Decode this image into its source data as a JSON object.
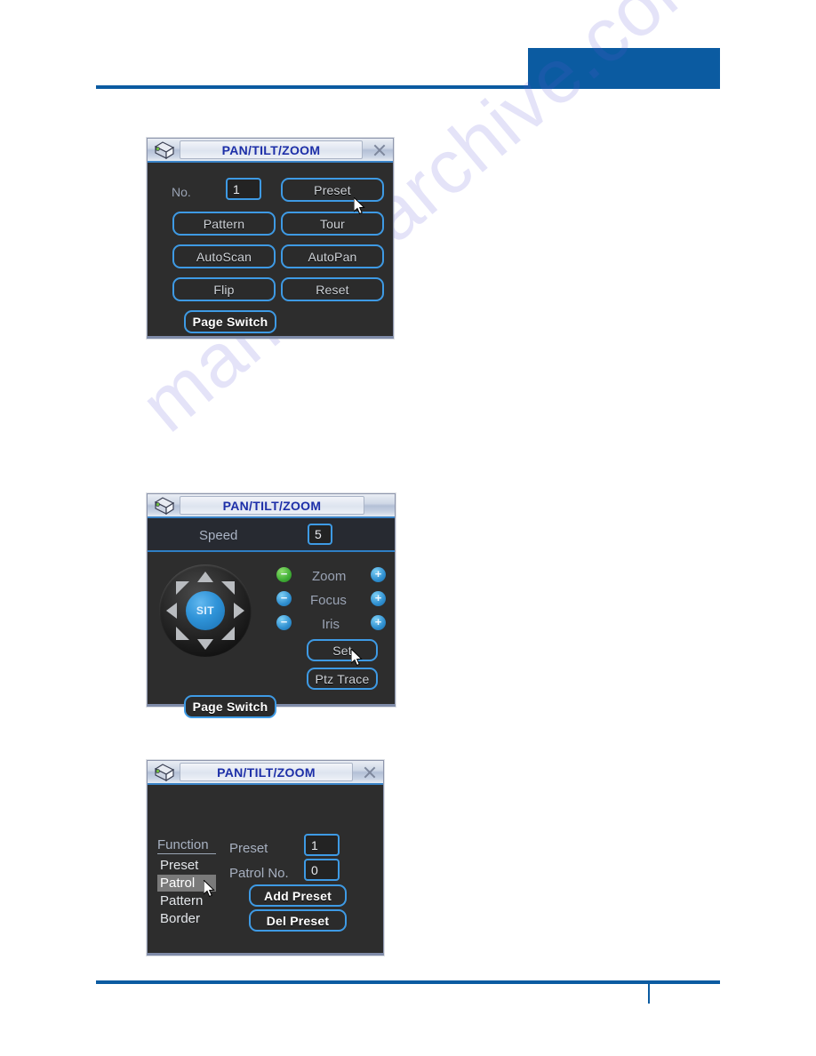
{
  "page": {
    "watermark": "manualsarchive.com",
    "accent_color": "#0b5ba1",
    "dialog_bg": "#2d2d2d",
    "button_border": "#3e9ae4"
  },
  "dialog1": {
    "title": "PAN/TILT/ZOOM",
    "close_label": "Close",
    "no_label": "No.",
    "no_value": "1",
    "buttons": [
      {
        "label": "Preset"
      },
      {
        "label": "Pattern"
      },
      {
        "label": "Tour"
      },
      {
        "label": "AutoScan"
      },
      {
        "label": "AutoPan"
      },
      {
        "label": "Flip"
      },
      {
        "label": "Reset"
      },
      {
        "label": "Page Switch"
      }
    ]
  },
  "dialog2": {
    "title": "PAN/TILT/ZOOM",
    "speed_label": "Speed",
    "speed_value": "5",
    "dpad_center_label": "SIT",
    "controls": [
      {
        "name": "Zoom",
        "minus": "−",
        "plus": "+",
        "minus_color": "green"
      },
      {
        "name": "Focus",
        "minus": "−",
        "plus": "+",
        "minus_color": "blue"
      },
      {
        "name": "Iris",
        "minus": "−",
        "plus": "+",
        "minus_color": "blue"
      }
    ],
    "buttons": [
      {
        "label": "Set"
      },
      {
        "label": "Ptz Trace"
      },
      {
        "label": "Page Switch"
      }
    ]
  },
  "dialog3": {
    "title": "PAN/TILT/ZOOM",
    "close_label": "Close",
    "function_header": "Function",
    "function_items": [
      {
        "label": "Preset",
        "selected": false
      },
      {
        "label": "Patrol",
        "selected": true
      },
      {
        "label": "Pattern",
        "selected": false
      },
      {
        "label": "Border",
        "selected": false
      }
    ],
    "preset_label": "Preset",
    "preset_value": "1",
    "patrol_label": "Patrol No.",
    "patrol_value": "0",
    "add_preset_label": "Add Preset",
    "del_preset_label": "Del Preset"
  }
}
